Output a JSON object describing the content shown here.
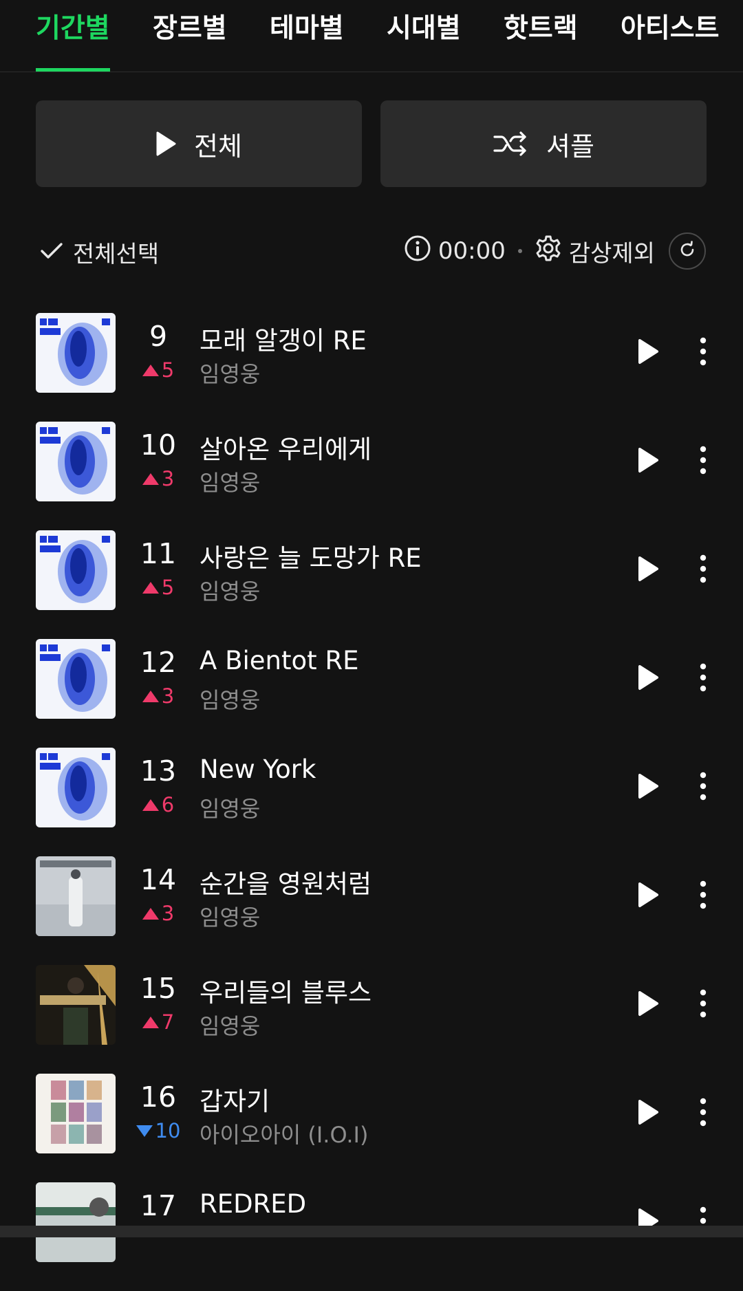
{
  "tabs": [
    {
      "label": "기간별",
      "active": true
    },
    {
      "label": "장르별",
      "active": false
    },
    {
      "label": "테마별",
      "active": false
    },
    {
      "label": "시대별",
      "active": false
    },
    {
      "label": "핫트랙",
      "active": false
    },
    {
      "label": "아티스트",
      "active": false
    }
  ],
  "actions": {
    "play_all_label": "전체",
    "shuffle_label": "셔플"
  },
  "toolbar": {
    "select_all_label": "전체선택",
    "time": "00:00",
    "exclude_label": "감상제외"
  },
  "colors": {
    "accent": "#1ed760",
    "rank_up": "#ef3a6a",
    "rank_down": "#3f8cf0",
    "background": "#131313",
    "button_bg": "#2b2b2b"
  },
  "songs": [
    {
      "rank": "9",
      "change": "5",
      "direction": "up",
      "title": "모래 알갱이 RE",
      "artist": "임영웅",
      "cover": "im-hero-blue"
    },
    {
      "rank": "10",
      "change": "3",
      "direction": "up",
      "title": "살아온 우리에게",
      "artist": "임영웅",
      "cover": "im-hero-blue"
    },
    {
      "rank": "11",
      "change": "5",
      "direction": "up",
      "title": "사랑은 늘 도망가 RE",
      "artist": "임영웅",
      "cover": "im-hero-blue"
    },
    {
      "rank": "12",
      "change": "3",
      "direction": "up",
      "title": "A Bientot RE",
      "artist": "임영웅",
      "cover": "im-hero-blue"
    },
    {
      "rank": "13",
      "change": "6",
      "direction": "up",
      "title": "New York",
      "artist": "임영웅",
      "cover": "im-hero-blue"
    },
    {
      "rank": "14",
      "change": "3",
      "direction": "up",
      "title": "순간을 영원처럼",
      "artist": "임영웅",
      "cover": "im-hero-2"
    },
    {
      "rank": "15",
      "change": "7",
      "direction": "up",
      "title": "우리들의 블루스",
      "artist": "임영웅",
      "cover": "im-hero-dark"
    },
    {
      "rank": "16",
      "change": "10",
      "direction": "down",
      "title": "갑자기",
      "artist": "아이오아이 (I.O.I)",
      "cover": "ioi-grid"
    },
    {
      "rank": "17",
      "change": "",
      "direction": "",
      "title": "REDRED",
      "artist": "",
      "cover": "redred"
    }
  ]
}
